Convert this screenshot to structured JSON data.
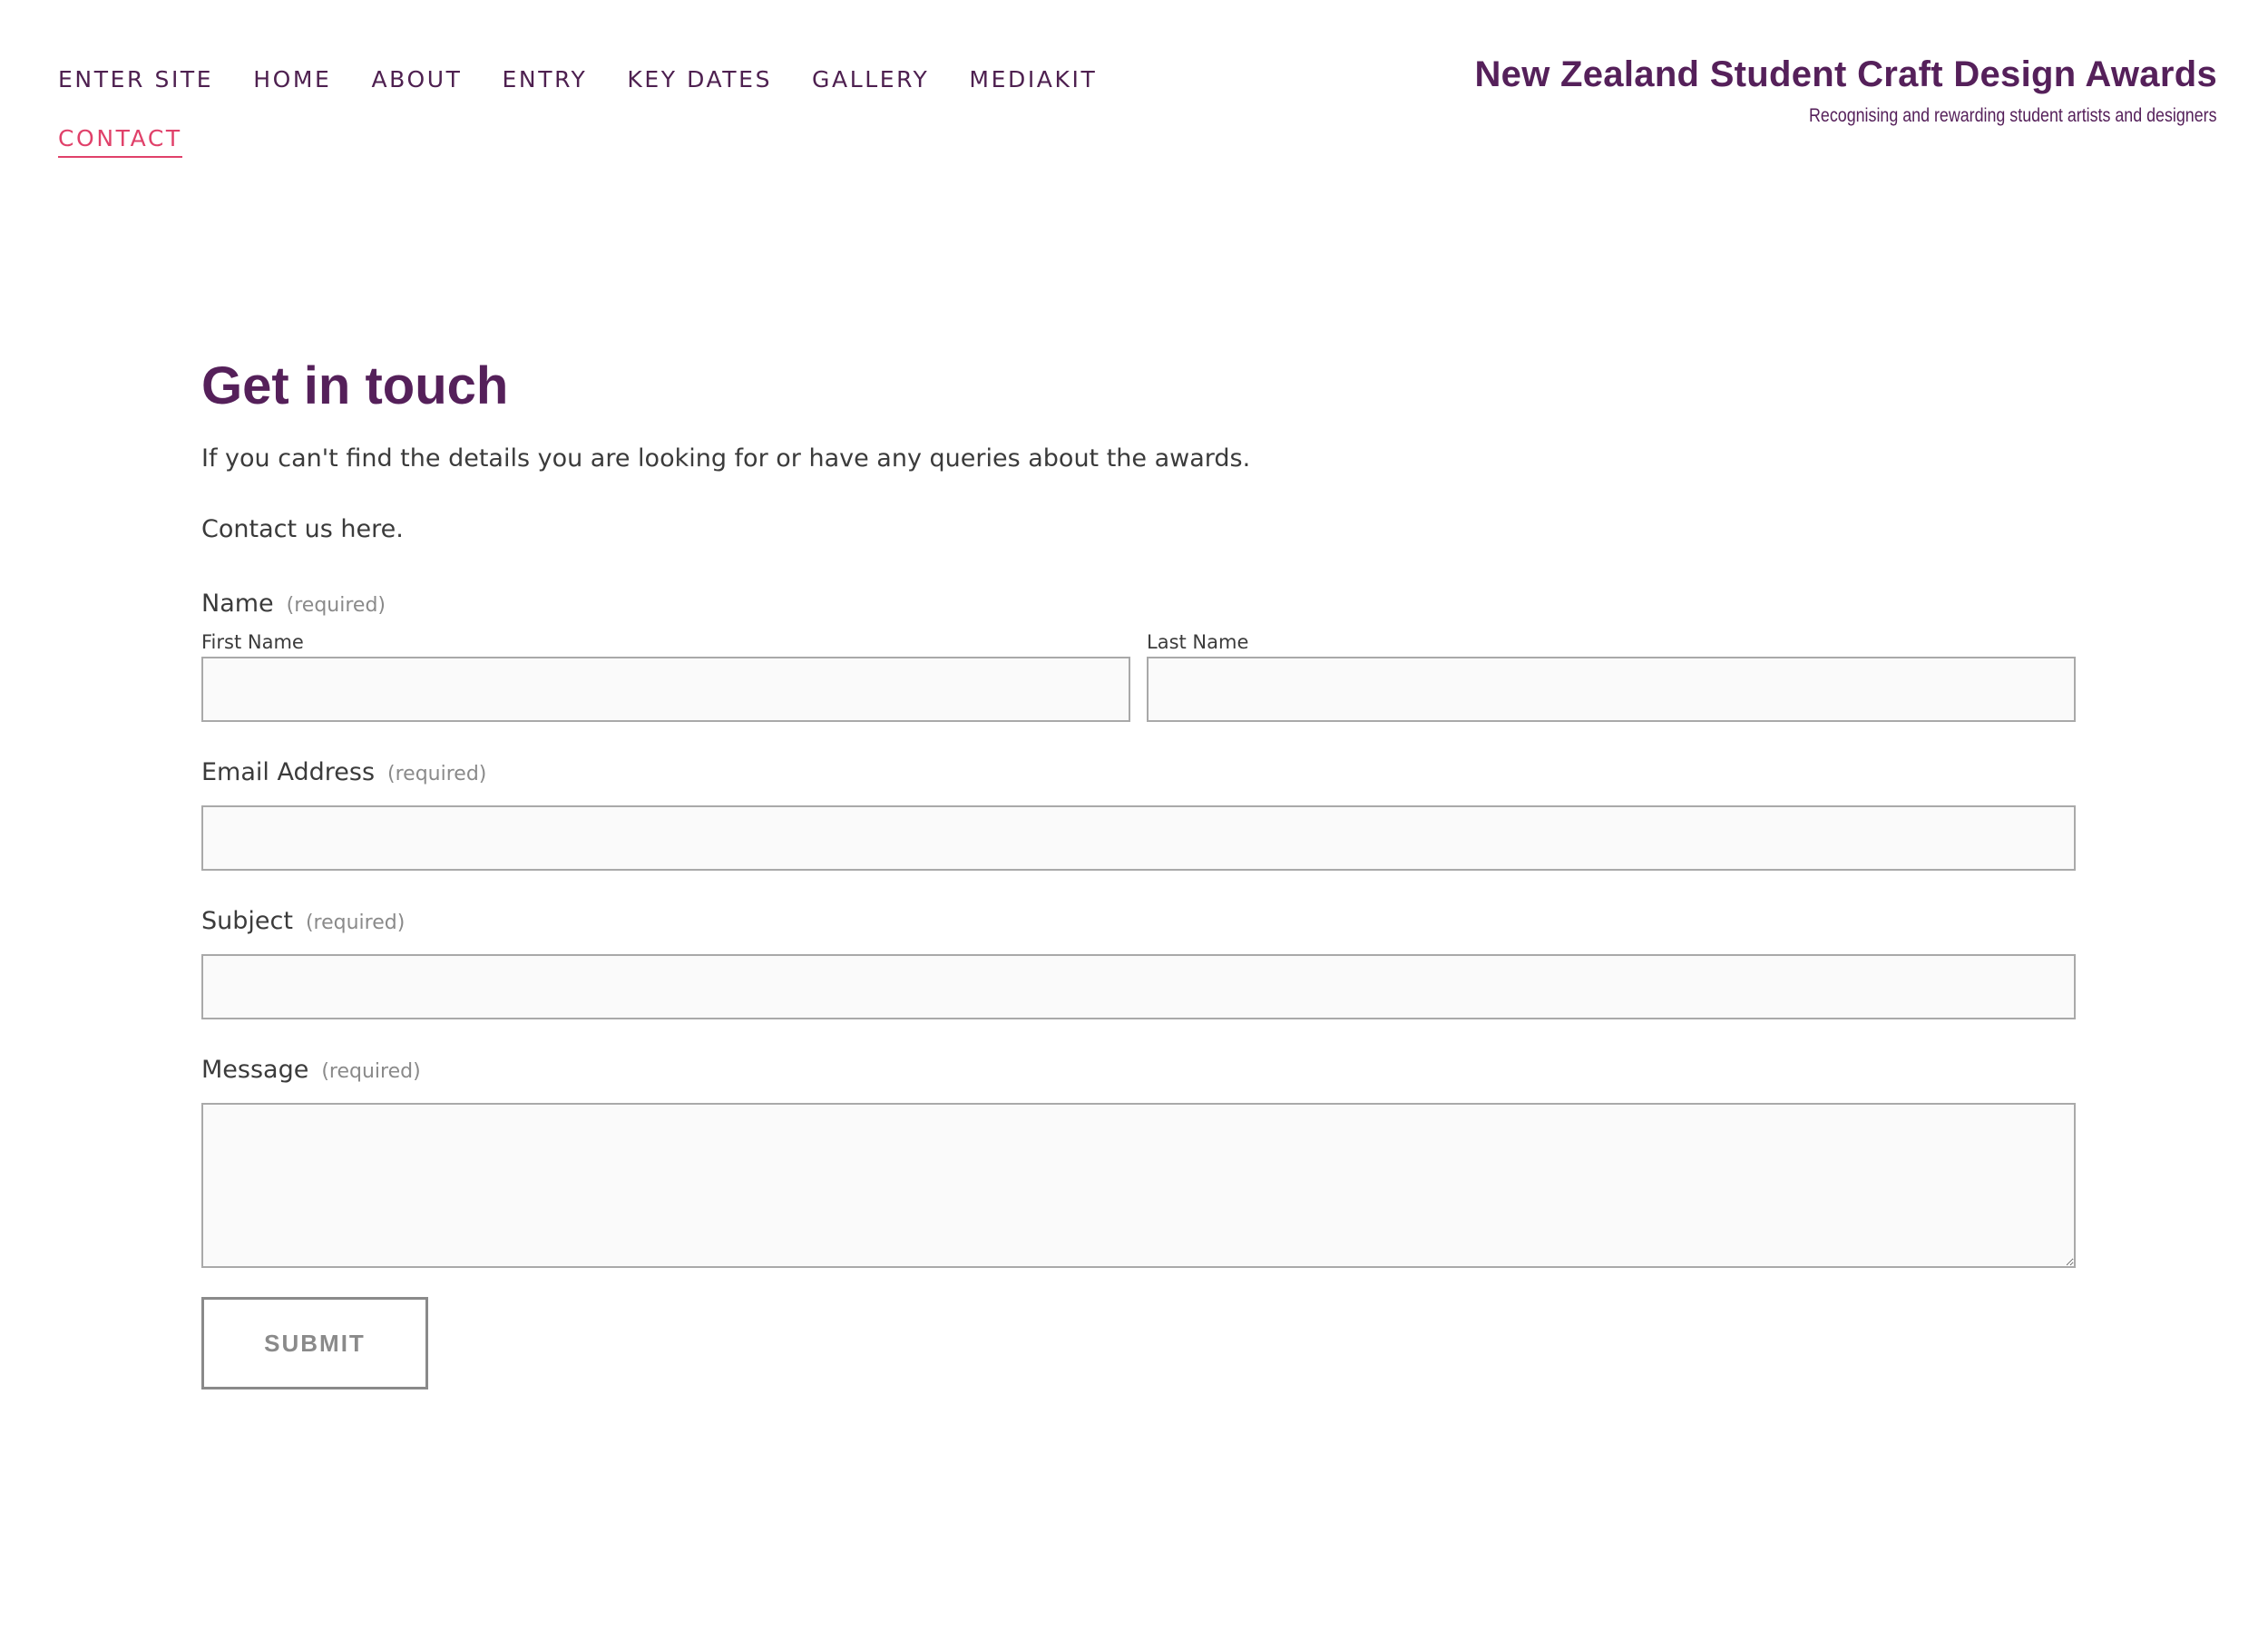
{
  "nav": {
    "items": [
      {
        "label": "ENTER SITE"
      },
      {
        "label": "HOME"
      },
      {
        "label": "ABOUT"
      },
      {
        "label": "ENTRY"
      },
      {
        "label": "KEY DATES"
      },
      {
        "label": "GALLERY"
      },
      {
        "label": "MEDIAKIT"
      },
      {
        "label": "CONTACT",
        "active": true
      }
    ]
  },
  "brand": {
    "title": "New Zealand Student Craft Design Awards",
    "tagline": "Recognising and rewarding student artists and designers"
  },
  "main": {
    "title": "Get in touch",
    "intro": "If you can't find the details you are looking for or have any queries about the awards.",
    "intro2": "Contact us here."
  },
  "form": {
    "name": {
      "label": "Name",
      "required": "(required)",
      "first_label": "First Name",
      "first_value": "",
      "last_label": "Last Name",
      "last_value": ""
    },
    "email": {
      "label": "Email Address",
      "required": "(required)",
      "value": ""
    },
    "subject": {
      "label": "Subject",
      "required": "(required)",
      "value": ""
    },
    "message": {
      "label": "Message",
      "required": "(required)",
      "value": ""
    },
    "submit_label": "SUBMIT"
  },
  "colors": {
    "brand_purple": "#55205a",
    "nav_purple": "#4e2050",
    "active_pink": "#e0416a",
    "input_bg": "#fafafa",
    "input_border": "#a9a9a9"
  }
}
